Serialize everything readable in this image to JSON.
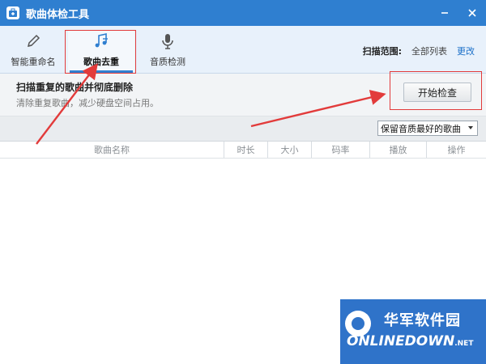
{
  "window": {
    "title": "歌曲体检工具"
  },
  "toolbar": {
    "tabs": [
      {
        "label": "智能重命名",
        "icon": "pencil-icon"
      },
      {
        "label": "歌曲去重",
        "icon": "music-note-icon"
      },
      {
        "label": "音质检测",
        "icon": "microphone-icon"
      }
    ],
    "scope_label": "扫描范围:",
    "scope_value": "全部列表",
    "scope_change": "更改"
  },
  "panel": {
    "title": "扫描重复的歌曲并彻底删除",
    "desc": "清除重复歌曲，减少硬盘空间占用。",
    "start_button": "开始检查"
  },
  "filter": {
    "selected": "保留音质最好的歌曲"
  },
  "table": {
    "columns": [
      "歌曲名称",
      "时长",
      "大小",
      "码率",
      "播放",
      "操作"
    ]
  },
  "watermark": {
    "cn": "华军软件园",
    "en": "ONLINEDOWN",
    "suffix": ".NET"
  },
  "colors": {
    "titlebar": "#2f7fd0",
    "annotation_red": "#e23b3b",
    "link": "#1a6fc8"
  }
}
